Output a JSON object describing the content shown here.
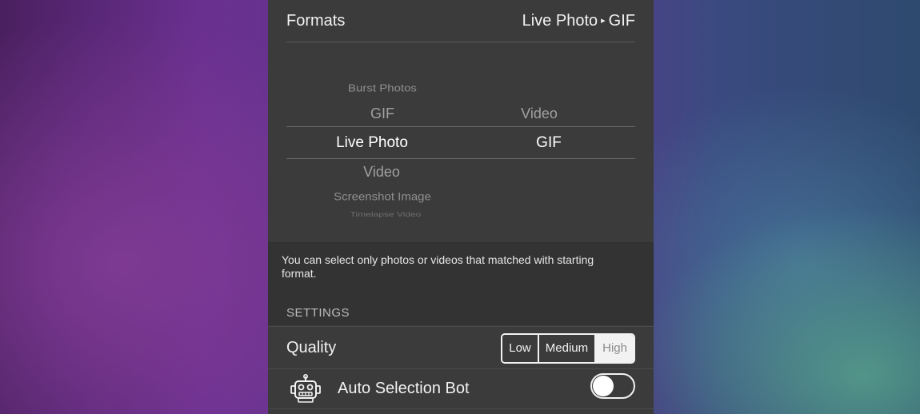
{
  "formats": {
    "label": "Formats",
    "from": "Live Photo",
    "arrow": "▸",
    "to": "GIF"
  },
  "picker": {
    "left_column": [
      "Burst Photos",
      "GIF",
      "Live Photo",
      "Video",
      "Screenshot Image",
      "Timelapse Video"
    ],
    "right_column": [
      "Video",
      "GIF"
    ],
    "selected_left": "Live Photo",
    "selected_right": "GIF"
  },
  "info": {
    "text": "You can select only photos or videos that matched with starting format."
  },
  "settings": {
    "header": "SETTINGS",
    "quality": {
      "label": "Quality",
      "options": [
        "Low",
        "Medium",
        "High"
      ],
      "selected": "High"
    },
    "auto_bot": {
      "label": "Auto Selection Bot",
      "icon": "robot-icon",
      "enabled": false
    }
  },
  "colors": {
    "panel": "#3b3b3b",
    "text": "#f2f2f2",
    "dim_text": "#9a9a9a"
  }
}
